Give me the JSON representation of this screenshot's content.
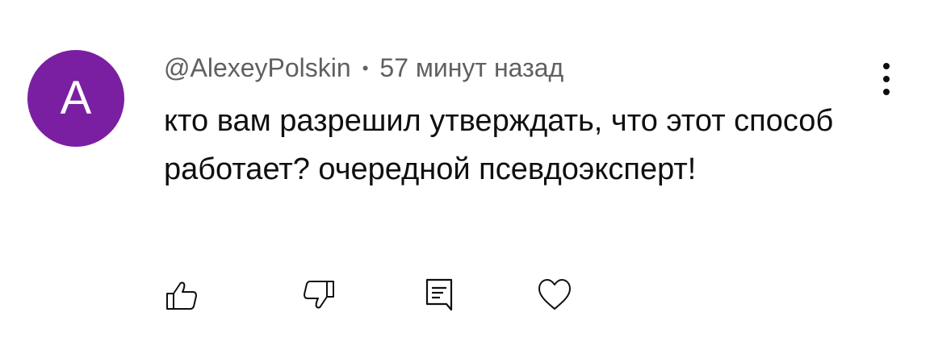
{
  "comment": {
    "avatar_letter": "A",
    "avatar_color": "#7b1fa2",
    "author": "@AlexeyPolskin",
    "separator": "•",
    "timestamp": "57 минут назад",
    "text": "кто вам разрешил утверждать, что этот способ работает? очередной псевдоэксперт!"
  },
  "actions": {
    "icons": [
      "like-icon",
      "dislike-icon",
      "reply-icon",
      "heart-icon",
      "more-vert-icon"
    ]
  }
}
